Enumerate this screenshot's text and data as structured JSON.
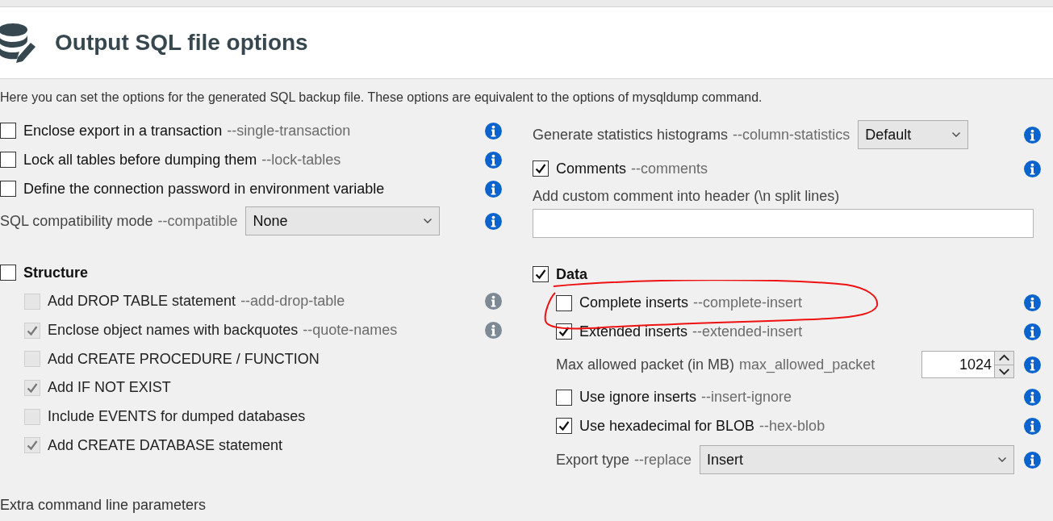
{
  "header": {
    "title": "Output SQL file options"
  },
  "description": "Here you can set the options for the generated SQL backup file. These options are equivalent to the options of mysqldump command.",
  "general_options": [
    {
      "kind": "checkbox",
      "label": "Enclose export in a transaction",
      "flag": "--single-transaction",
      "checked": false,
      "info": true
    },
    {
      "kind": "checkbox",
      "label": "Lock all tables before dumping them",
      "flag": "--lock-tables",
      "checked": false,
      "info": true
    },
    {
      "kind": "checkbox",
      "label": "Define the connection password in environment variable",
      "checked": false,
      "info": true
    },
    {
      "kind": "select",
      "label": "SQL compatibility mode",
      "flag": "--compatible",
      "value": "None",
      "info": true
    }
  ],
  "structure": {
    "label": "Structure",
    "checked": false,
    "items": [
      {
        "label": "Add DROP TABLE statement",
        "flag": "--add-drop-table",
        "checked": false,
        "disabled": true,
        "info": true
      },
      {
        "label": "Enclose object names with backquotes",
        "flag": "--quote-names",
        "checked": true,
        "disabled": true,
        "info": true
      },
      {
        "label": "Add CREATE PROCEDURE / FUNCTION",
        "checked": false,
        "disabled": true,
        "info": false
      },
      {
        "label": "Add IF NOT EXIST",
        "checked": true,
        "disabled": true,
        "info": false
      },
      {
        "label": "Include EVENTS for dumped databases",
        "checked": false,
        "disabled": true,
        "info": false
      },
      {
        "label": "Add CREATE DATABASE statement",
        "checked": true,
        "disabled": true,
        "info": false
      }
    ]
  },
  "output_options": [
    {
      "kind": "select",
      "label": "Generate statistics histograms",
      "flag": "--column-statistics",
      "value": "Default",
      "info": true
    },
    {
      "kind": "checkbox",
      "label": "Comments",
      "flag": "--comments",
      "checked": true,
      "info": true
    },
    {
      "kind": "text",
      "label": "Add custom comment into header (\\n split lines)"
    }
  ],
  "data": {
    "label": "Data",
    "checked": true,
    "items": [
      {
        "kind": "checkbox",
        "label": "Complete inserts",
        "flag": "--complete-insert",
        "checked": false,
        "info": true
      },
      {
        "kind": "checkbox",
        "label": "Extended inserts",
        "flag": "--extended-insert",
        "checked": true,
        "info": true
      },
      {
        "kind": "number",
        "label": "Max allowed packet (in MB)",
        "flag": "max_allowed_packet",
        "value": "1024",
        "info": true
      },
      {
        "kind": "checkbox",
        "label": "Use ignore inserts",
        "flag": "--insert-ignore",
        "checked": false,
        "info": true
      },
      {
        "kind": "checkbox",
        "label": "Use hexadecimal for BLOB",
        "flag": "--hex-blob",
        "checked": true,
        "info": true
      },
      {
        "kind": "select",
        "label": "Export type",
        "flag": "--replace",
        "value": "Insert",
        "info": true
      }
    ]
  },
  "footer": {
    "label": "Extra command line parameters"
  }
}
